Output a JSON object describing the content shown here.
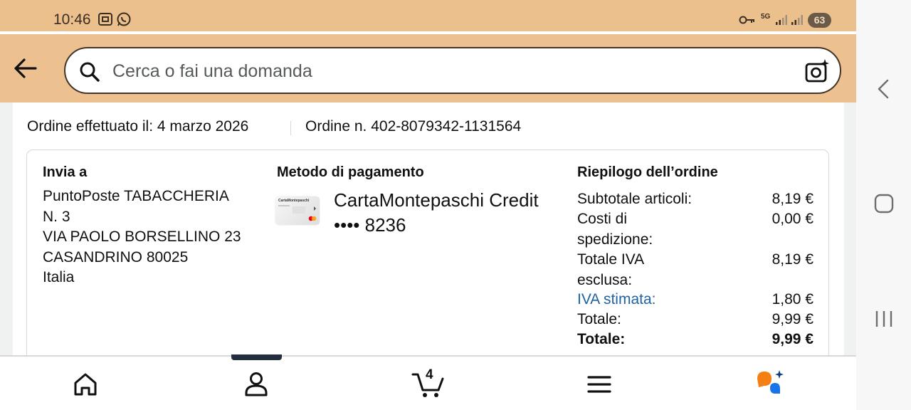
{
  "status_bar": {
    "time": "10:46",
    "network": "5G",
    "battery": "63"
  },
  "search": {
    "placeholder": "Cerca o fai una domanda"
  },
  "order": {
    "date_text": "Ordine effettuato il: 4 marzo 2026",
    "number_text": "Ordine n. 402-8079342-1131564"
  },
  "ship_to": {
    "heading": "Invia a",
    "lines": [
      "PuntoPoste TABACCHERIA",
      "N. 3",
      "VIA PAOLO BORSELLINO 23",
      "CASANDRINO 80025",
      "Italia"
    ]
  },
  "payment": {
    "heading": "Metodo di pagamento",
    "card_name": "CartaMontepaschi Credit",
    "card_number": "•••• 8236",
    "card_image_label": "CartaMontepaschi"
  },
  "summary": {
    "heading": "Riepilogo dell’ordine",
    "rows": [
      {
        "label": "Subtotale articoli:",
        "value": "8,19 €"
      },
      {
        "label": "Costi di spedizione:",
        "value": "0,00 €"
      },
      {
        "label": "Totale IVA esclusa:",
        "value": "8,19 €"
      },
      {
        "label": "IVA stimata:",
        "value": "1,80 €"
      },
      {
        "label": "Totale:",
        "value": "9,99 €"
      },
      {
        "label": "Totale:",
        "value": "9,99 €"
      }
    ]
  },
  "bottom_nav": {
    "cart_count": "4",
    "items": [
      "home-icon",
      "account-icon",
      "cart-icon",
      "menu-icon",
      "rufus-icon"
    ]
  },
  "colors": {
    "header_bg": "#edc18f",
    "link": "#2162a1",
    "text": "#0f1111"
  }
}
